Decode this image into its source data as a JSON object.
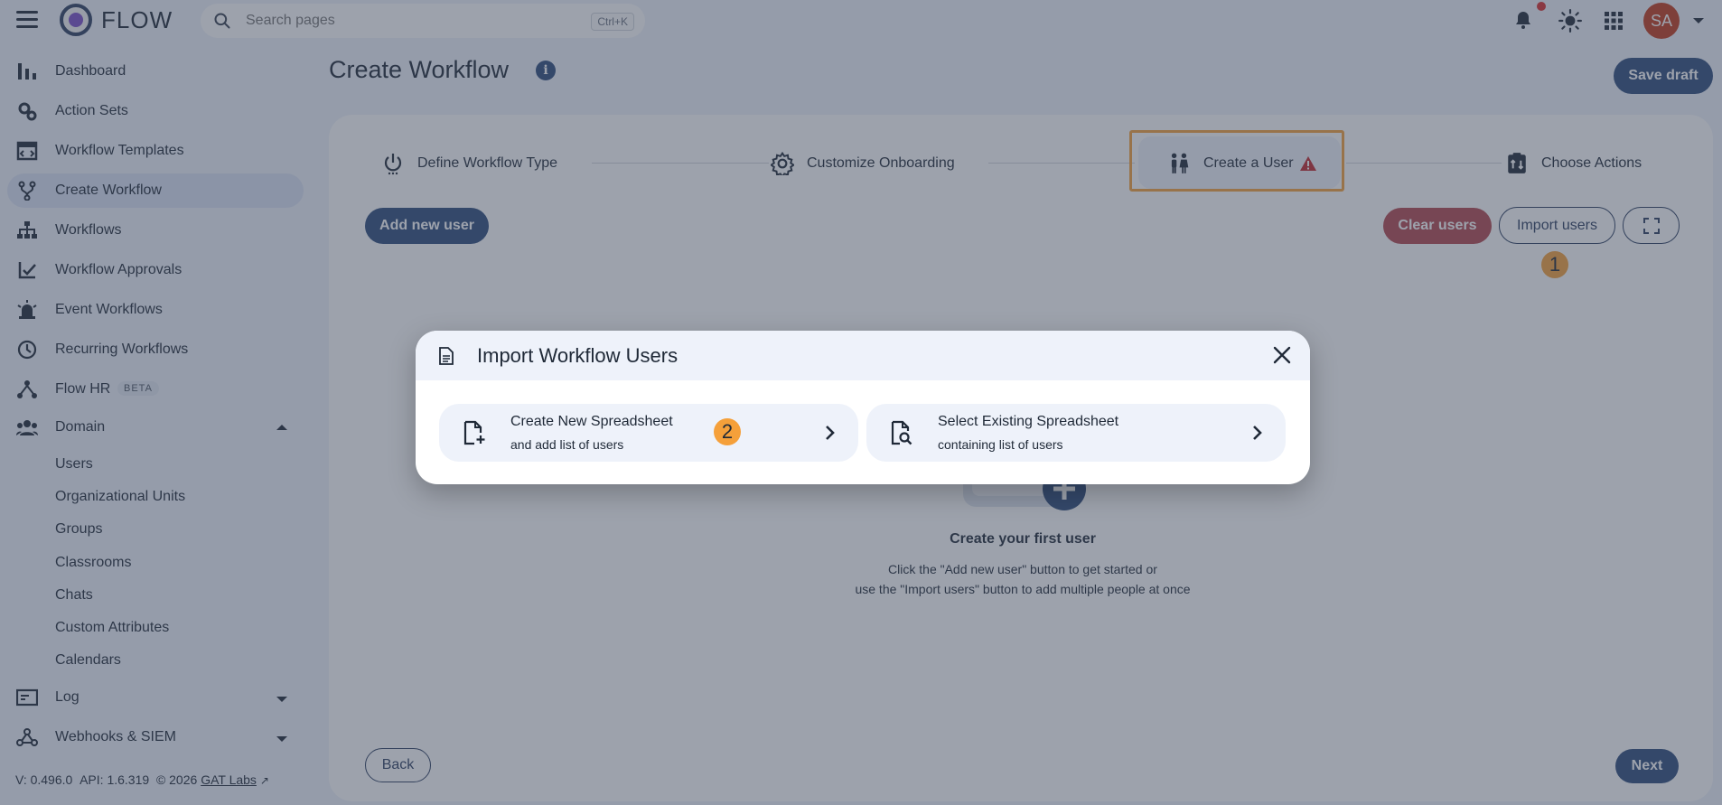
{
  "app": {
    "name": "FLOW"
  },
  "search": {
    "placeholder": "Search pages",
    "shortcut": "Ctrl+K"
  },
  "user": {
    "initials": "SA"
  },
  "sidebar": {
    "items": [
      {
        "label": "Dashboard",
        "icon": "bar-chart-icon"
      },
      {
        "label": "Action Sets",
        "icon": "gears-icon"
      },
      {
        "label": "Workflow Templates",
        "icon": "template-icon"
      },
      {
        "label": "Create Workflow",
        "icon": "fork-icon"
      },
      {
        "label": "Workflows",
        "icon": "hierarchy-icon"
      },
      {
        "label": "Workflow Approvals",
        "icon": "approval-icon"
      },
      {
        "label": "Event Workflows",
        "icon": "alarm-icon"
      },
      {
        "label": "Recurring Workflows",
        "icon": "clock-icon"
      },
      {
        "label": "Flow HR",
        "icon": "org-icon",
        "badge": "BETA"
      },
      {
        "label": "Domain",
        "icon": "people-icon"
      },
      {
        "label": "Log",
        "icon": "log-icon"
      },
      {
        "label": "Webhooks & SIEM",
        "icon": "webhook-icon"
      }
    ],
    "domain_children": [
      "Users",
      "Organizational Units",
      "Groups",
      "Classrooms",
      "Chats",
      "Custom Attributes",
      "Calendars"
    ],
    "version": "V: 0.496.0",
    "api": "API: 1.6.319",
    "copyright": "© 2026",
    "company_link": "GAT Labs"
  },
  "page": {
    "title": "Create Workflow",
    "save_draft": "Save draft",
    "steps": [
      "Define Workflow Type",
      "Customize Onboarding",
      "Create a User",
      "Choose Actions"
    ],
    "add_user": "Add new user",
    "clear_users": "Clear users",
    "import_users": "Import users",
    "marker_1": "1",
    "marker_2": "2",
    "empty_title": "Create your first user",
    "empty_line1": "Click the \"Add new user\" button to get started or",
    "empty_line2": "use the \"Import users\" button to add multiple people at once",
    "back": "Back",
    "next": "Next"
  },
  "dialog": {
    "title": "Import Workflow Users",
    "options": [
      {
        "title": "Create New Spreadsheet",
        "subtitle": "and add list of users"
      },
      {
        "title": "Select Existing Spreadsheet",
        "subtitle": "containing list of users"
      }
    ]
  },
  "colors": {
    "primary": "#2c4a7a",
    "danger": "#b3474e",
    "highlight": "#f5a03a",
    "avatar": "#c0391b"
  }
}
